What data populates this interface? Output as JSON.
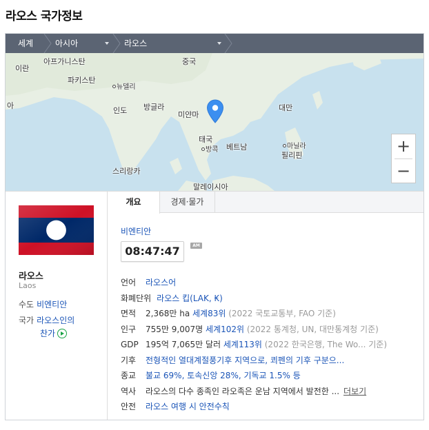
{
  "page_title": "라오스 국가정보",
  "breadcrumb": {
    "world": "세계",
    "region": "아시아",
    "country": "라오스"
  },
  "map": {
    "labels": {
      "iran": "이란",
      "afghanistan": "아프가니스탄",
      "pakistan": "파키스탄",
      "new_delhi": "뉴델리",
      "china": "중국",
      "india": "인도",
      "bangladesh": "방글라",
      "myanmar": "미얀마",
      "taiwan": "대만",
      "thailand": "태국",
      "bangkok": "방콕",
      "vietnam": "베트남",
      "manila": "마닐라",
      "philippines": "필리핀",
      "srilanka": "스리랑카",
      "malaysia": "말레이시아",
      "iran_left": "아"
    },
    "zoom_in": "+",
    "zoom_out": "−"
  },
  "country": {
    "name": "라오스",
    "name_en": "Laos",
    "capital_label": "수도",
    "capital_value": "비엔티안",
    "anthem_label": "국가",
    "anthem_value_1": "라오스인의",
    "anthem_value_2": "찬가"
  },
  "tabs": {
    "overview": "개요",
    "economy": "경제·물가"
  },
  "overview": {
    "capital_city": "비엔티안",
    "time": "08:47:47",
    "ampm": "AM",
    "language": {
      "k": "언어",
      "v": "라오스어"
    },
    "currency": {
      "k": "화폐단위",
      "v": "라오스 킵(LAK, ₭)"
    },
    "area": {
      "k": "면적",
      "v": "2,368만 ha",
      "rank": "세계83위",
      "note": "(2022 국토교통부, FAO 기준)"
    },
    "population": {
      "k": "인구",
      "v": "755만 9,007명",
      "rank": "세계102위",
      "note": "(2022 통계청, UN, 대만통계청 기준)"
    },
    "gdp": {
      "k": "GDP",
      "v": "195억 7,065만 달러",
      "rank": "세계113위",
      "note": "(2022 한국은행, The Wo...  기준)"
    },
    "climate": {
      "k": "기후",
      "v": "전형적인 열대계절풍기후 지역으로, 쾨펜의 기후 구분으..."
    },
    "religion": {
      "k": "종교",
      "v": "불교 69%, 토속신앙 28%, 기독교 1.5% 등"
    },
    "history": {
      "k": "역사",
      "v": "라오스의 다수 종족인 라오족은 운남 지역에서 발전한 ...",
      "more": "더보기"
    },
    "safety": {
      "k": "안전",
      "v": "라오스 여행 시 안전수칙"
    }
  },
  "colors": {
    "link": "#1a54b7",
    "breadcrumb_bg": "#5b6473",
    "pin": "#3c8ff0",
    "flag_red": "#ce1126",
    "flag_blue": "#002868"
  },
  "icons": {
    "pin": "map-pin-icon",
    "play": "play-icon",
    "zoom_in": "plus-icon",
    "zoom_out": "minus-icon"
  }
}
